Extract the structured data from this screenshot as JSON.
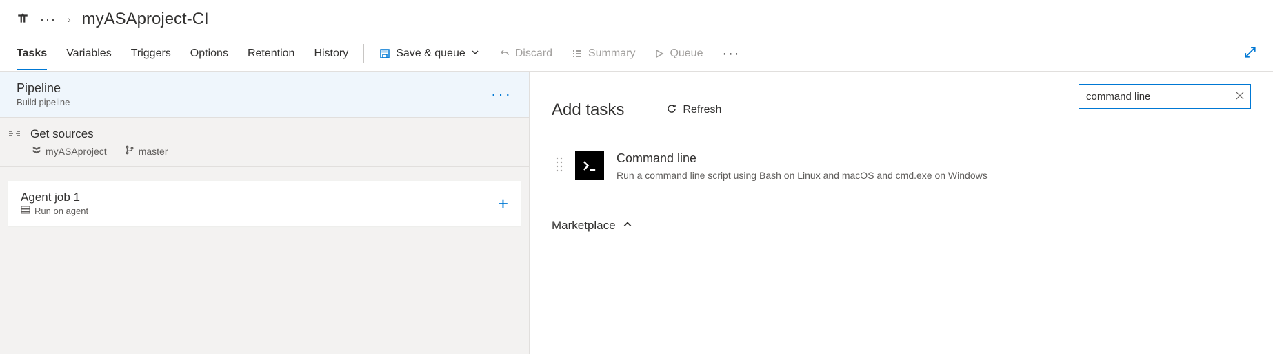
{
  "breadcrumb": {
    "ellipsis": "···",
    "separator": "›",
    "title": "myASAproject-CI"
  },
  "tabs": [
    "Tasks",
    "Variables",
    "Triggers",
    "Options",
    "Retention",
    "History"
  ],
  "activeTab": 0,
  "toolbar": {
    "save_queue": "Save & queue",
    "discard": "Discard",
    "summary": "Summary",
    "queue": "Queue",
    "more": "···"
  },
  "pipeline": {
    "title": "Pipeline",
    "subtitle": "Build pipeline",
    "more": "···"
  },
  "get_sources": {
    "title": "Get sources",
    "repo": "myASAproject",
    "branch": "master"
  },
  "agent_job": {
    "title": "Agent job 1",
    "subtitle": "Run on agent"
  },
  "add_tasks": {
    "heading": "Add tasks",
    "refresh": "Refresh",
    "search_value": "command line"
  },
  "task_result": {
    "title": "Command line",
    "description": "Run a command line script using Bash on Linux and macOS and cmd.exe on Windows"
  },
  "marketplace": {
    "label": "Marketplace"
  }
}
